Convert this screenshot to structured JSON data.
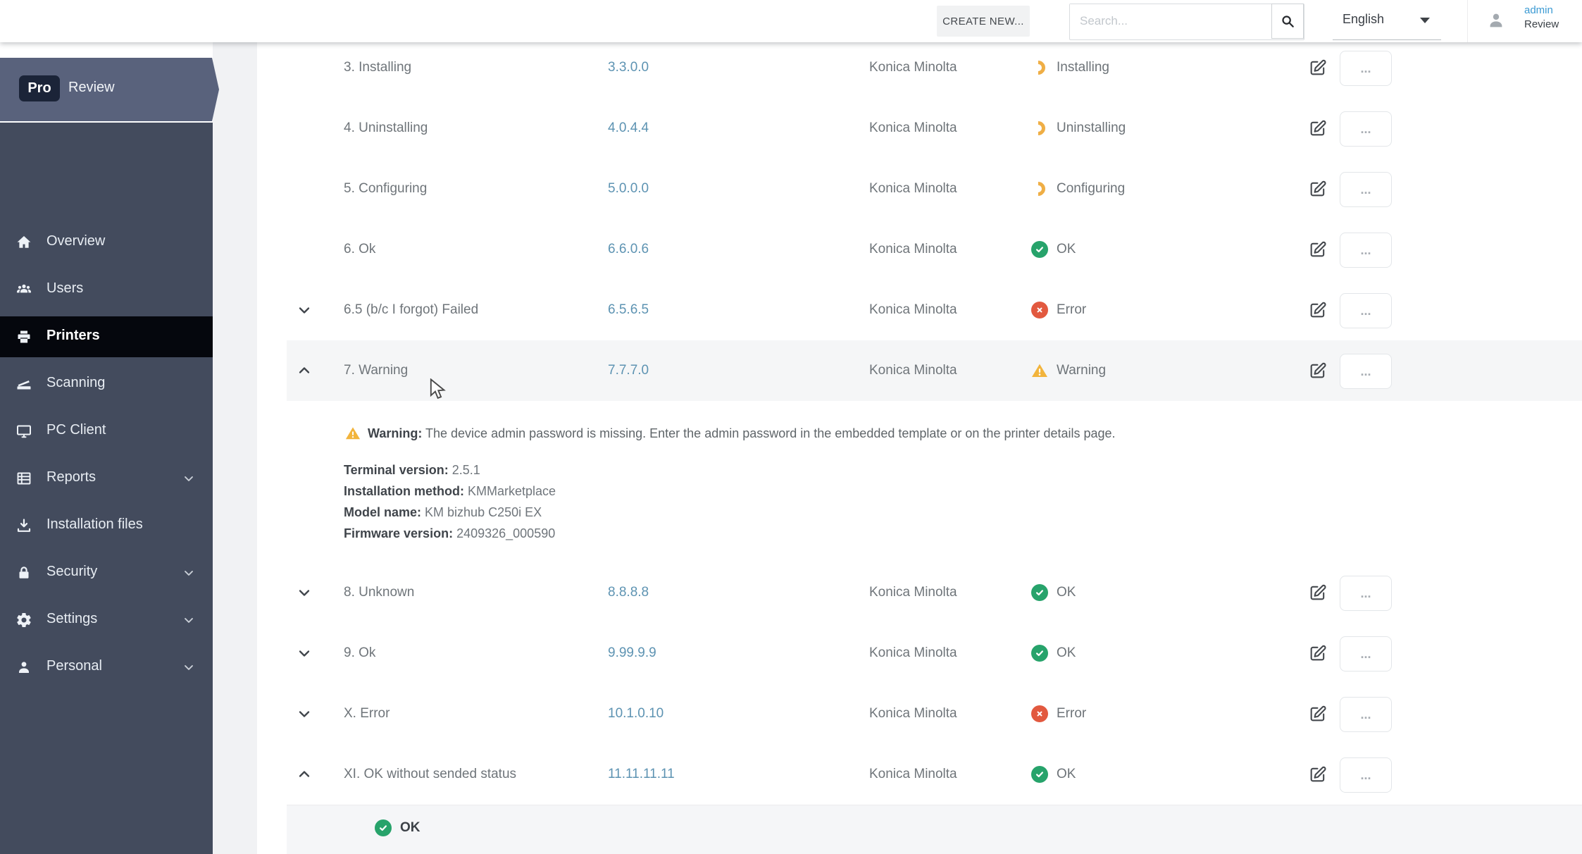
{
  "topbar": {
    "create_new_label": "CREATE NEW...",
    "search_placeholder": "Search...",
    "language": "English",
    "user_name": "admin",
    "user_role": "Review"
  },
  "sidebar": {
    "brand_badge": "Pro",
    "brand_name": "Review",
    "items": [
      {
        "label": "Overview",
        "icon": "home-icon",
        "active": false,
        "chevron": false
      },
      {
        "label": "Users",
        "icon": "users-icon",
        "active": false,
        "chevron": false
      },
      {
        "label": "Printers",
        "icon": "printer-icon",
        "active": true,
        "chevron": false
      },
      {
        "label": "Scanning",
        "icon": "scanner-icon",
        "active": false,
        "chevron": false
      },
      {
        "label": "PC Client",
        "icon": "monitor-icon",
        "active": false,
        "chevron": false
      },
      {
        "label": "Reports",
        "icon": "report-icon",
        "active": false,
        "chevron": true
      },
      {
        "label": "Installation files",
        "icon": "download-icon",
        "active": false,
        "chevron": false
      },
      {
        "label": "Security",
        "icon": "lock-icon",
        "active": false,
        "chevron": true
      },
      {
        "label": "Settings",
        "icon": "gear-icon",
        "active": false,
        "chevron": true
      },
      {
        "label": "Personal",
        "icon": "person-icon",
        "active": false,
        "chevron": true
      }
    ]
  },
  "table": {
    "more_label": "...",
    "rows": [
      {
        "name": "3. Installing",
        "version": "3.3.0.0",
        "vendor": "Konica Minolta",
        "status_kind": "progress",
        "status_label": "Installing",
        "chevron": null,
        "highlighted": false
      },
      {
        "name": "4. Uninstalling",
        "version": "4.0.4.4",
        "vendor": "Konica Minolta",
        "status_kind": "progress",
        "status_label": "Uninstalling",
        "chevron": null,
        "highlighted": false
      },
      {
        "name": "5. Configuring",
        "version": "5.0.0.0",
        "vendor": "Konica Minolta",
        "status_kind": "progress",
        "status_label": "Configuring",
        "chevron": null,
        "highlighted": false
      },
      {
        "name": "6. Ok",
        "version": "6.6.0.6",
        "vendor": "Konica Minolta",
        "status_kind": "ok",
        "status_label": "OK",
        "chevron": null,
        "highlighted": false
      },
      {
        "name": "6.5 (b/c I forgot) Failed",
        "version": "6.5.6.5",
        "vendor": "Konica Minolta",
        "status_kind": "error",
        "status_label": "Error",
        "chevron": "down",
        "highlighted": false
      },
      {
        "name": "7. Warning",
        "version": "7.7.7.0",
        "vendor": "Konica Minolta",
        "status_kind": "warning",
        "status_label": "Warning",
        "chevron": "up",
        "highlighted": true
      },
      {
        "name": "8. Unknown",
        "version": "8.8.8.8",
        "vendor": "Konica Minolta",
        "status_kind": "ok",
        "status_label": "OK",
        "chevron": "down",
        "highlighted": false
      },
      {
        "name": "9. Ok",
        "version": "9.99.9.9",
        "vendor": "Konica Minolta",
        "status_kind": "ok",
        "status_label": "OK",
        "chevron": "down",
        "highlighted": false
      },
      {
        "name": "X. Error",
        "version": "10.1.0.10",
        "vendor": "Konica Minolta",
        "status_kind": "error",
        "status_label": "Error",
        "chevron": "down",
        "highlighted": false
      },
      {
        "name": "XI. OK without sended status",
        "version": "11.11.11.11",
        "vendor": "Konica Minolta",
        "status_kind": "ok",
        "status_label": "OK",
        "chevron": "up",
        "highlighted": false
      }
    ]
  },
  "expanded_warning": {
    "title": "Warning:",
    "message": "The device admin password is missing. Enter the admin password in the embedded template or on the printer details page.",
    "details": [
      {
        "label": "Terminal version:",
        "value": "2.5.1"
      },
      {
        "label": "Installation method:",
        "value": "KMMarketplace"
      },
      {
        "label": "Model name:",
        "value": "KM bizhub C250i EX"
      },
      {
        "label": "Firmware version:",
        "value": "2409326_000590"
      }
    ]
  },
  "expanded_ok": {
    "label": "OK"
  },
  "colors": {
    "ok": "#27a36b",
    "error": "#e2593f",
    "warning": "#f2b43c",
    "progress": "#efae45",
    "link": "#3b9ad3",
    "sidebar_header": "#59627c",
    "sidebar_body": "#434b5d",
    "sidebar_active": "#05070d",
    "version_text": "#5d93b2"
  }
}
